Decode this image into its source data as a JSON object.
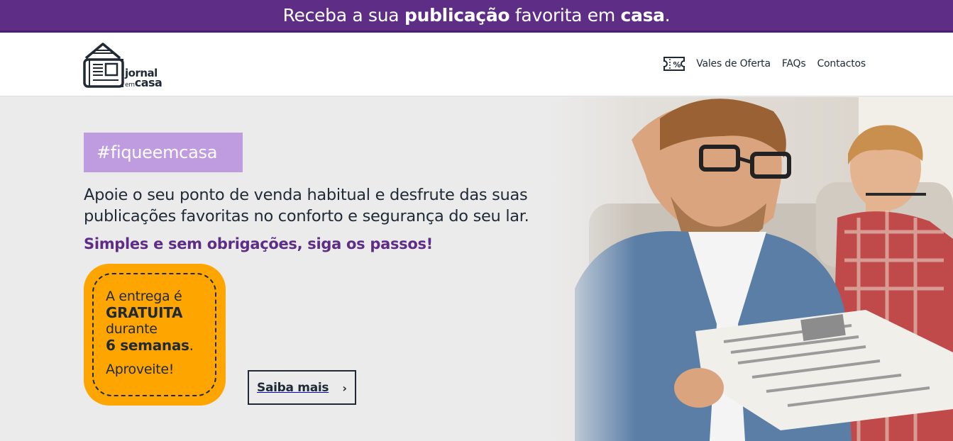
{
  "promo": {
    "part1": "Receba a sua ",
    "bold1": "publicação",
    "part2": " favorita em ",
    "bold2": "casa",
    "part3": "."
  },
  "header": {
    "logo": {
      "line1": "jornal",
      "line2_small": "em",
      "line2": "casa"
    },
    "nav": {
      "coupon_icon": "coupon-percent-icon",
      "items": [
        "Vales de Oferta",
        "FAQs",
        "Contactos"
      ]
    }
  },
  "hero": {
    "hashtag": "#fiqueemcasa",
    "lead_line1": "Apoie o seu ponto de venda habitual e desfrute das suas",
    "lead_line2": "publicações favoritas no conforto e segurança do seu lar.",
    "subheading": "Simples e sem obrigações, siga os passos!",
    "offer": {
      "line1": "A entrega é",
      "line2": "GRATUITA",
      "line3": "durante",
      "line4": "6 semanas",
      "line4_suffix": ".",
      "line5": "Aproveite!"
    },
    "cta_label": "Saiba mais",
    "cta_icon": "chevron-right-icon",
    "photo": "father-and-son-reading-newspaper"
  },
  "colors": {
    "brand_purple": "#5e2d86",
    "hashtag_lilac": "#bf9be0",
    "offer_orange": "#ffa500",
    "text_dark": "#1f2a36"
  }
}
